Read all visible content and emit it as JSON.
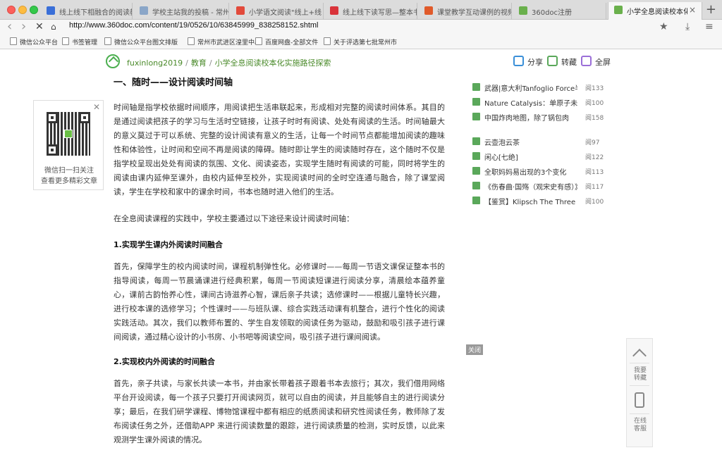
{
  "tabs": [
    {
      "label": "线上线下相融合的阅读教",
      "favicon_color": "#3a6fd8"
    },
    {
      "label": "学校主站我的投稿 - 常州",
      "favicon_color": "#8aa6c8"
    },
    {
      "label": "小学语文阅读\"线上+线",
      "favicon_color": "#e24a3b"
    },
    {
      "label": "线上线下读写思—整本书",
      "favicon_color": "#d9333a"
    },
    {
      "label": "课堂教学互动课例的视频",
      "favicon_color": "#e05a2a"
    },
    {
      "label": "360doc注册",
      "favicon_color": "#6ab04c"
    },
    {
      "label": "小学全息阅读校本化实施",
      "favicon_color": "#6ab04c",
      "active": true
    }
  ],
  "address": {
    "url": "http://www.360doc.com/content/19/0526/10/63845999_838258152.shtml"
  },
  "bookmarks": [
    "微信公众平台",
    "书签管理",
    "微信公众平台图文排版",
    "常州市武进区湟里中心",
    "百度网盘-全部文件",
    "关于评选第七批常州市"
  ],
  "breadcrumb": {
    "user": "fuxinlong2019",
    "section": "教育",
    "title": "小学全息阅读校本化实施路径探索"
  },
  "toolbar": {
    "share": "分享",
    "repost": "转藏",
    "fullscreen": "全屏"
  },
  "qr": {
    "caption": "微信扫一扫关注\n查看更多精彩文章"
  },
  "article": {
    "heading": "一、随时——设计阅读时间轴",
    "p1": "时间轴是指学校依据时间顺序，用阅读把生活串联起来，形成相对完整的阅读时间体系。其目的是通过阅读把孩子的学习与生活时空链接，让孩子时时有阅读、处处有阅读的生活。时间轴最大的意义莫过于可以系统、完整的设计阅读有意义的生活，让每一个时间节点都能增加阅读的趣味性和体验性，让时间和空间不再是阅读的障碍。随时即让学生的阅读随时存在，这个随时不仅是指学校呈现出处处有阅读的氛围、文化、阅读姿态，实现学生随时有阅读的可能，同时将学生的阅读由课内延伸至课外，由校内延伸至校外，实现阅读时间的全时空连通与融合，除了课堂阅读，学生在学校和家中的课余时间，书本也随时进入他们的生活。",
    "p2": "在全息阅读课程的实践中，学校主要通过以下途径来设计阅读时间轴：",
    "sub1": "1.实现学生课内外阅读时间融合",
    "p3": "首先，保障学生的校内阅读时间，课程机制弹性化。必修课时——每周一节语文课保证整本书的指导阅读，每周一节晨诵课进行经典积累，每周一节阅读短课进行阅读分享，清晨绘本蕴养童心，课前古韵怡养心性，课间古诗滋养心智，课后亲子共读；选修课时——根据儿童特长兴趣，进行校本课的选修学习；个性课时——与班队课、综合实践活动课有机整合，进行个性化的阅读实践活动。其次，我们以教师布置的、学生自发领取的阅读任务为驱动，鼓励和吸引孩子进行课间阅读，通过精心设计的小书房、小书吧等阅读空间，吸引孩子进行课间阅读。",
    "sub2": "2.实现校内外阅读的时间融合",
    "p4": "首先，亲子共读，与家长共读一本书，并由家长带着孩子跟着书本去旅行；其次，我们借用网络平台开设阅读，每一个孩子只要打开阅读网页，就可以自由的阅读，并且能够自主的进行阅读分享；最后，在我们研学课程、博物馆课程中都有相应的纸质阅读和研究性阅读任务，教师除了发布阅读任务之外，还借助APP 来进行阅读数量的跟踪，进行阅读质量的检测，实时反馈，以此来观测学生课外阅读的情况。"
  },
  "sidebar": [
    {
      "title": "武器|意大利Tanfoglio Force半自动手枪",
      "count": "阅133"
    },
    {
      "title": "Nature Catalysis：单原子未来",
      "count": "阅100"
    },
    {
      "title": "中国炸肉地图，除了锅包肉",
      "count": "阅158"
    },
    {
      "title": "云壶泡云茶",
      "count": "阅97"
    },
    {
      "title": "闲心[七绝]",
      "count": "阅122"
    },
    {
      "title": "全职妈妈易出现的3个变化",
      "count": "阅113"
    },
    {
      "title": "《伤春曲·国殇（观宋史有感）》",
      "count": "阅117"
    },
    {
      "title": "【鉴赏】Klipsch The Three II音箱",
      "count": "阅100"
    }
  ],
  "close_label": "关闭",
  "rail": {
    "favorite": "我要\n转藏",
    "service": "在线\n客服"
  }
}
